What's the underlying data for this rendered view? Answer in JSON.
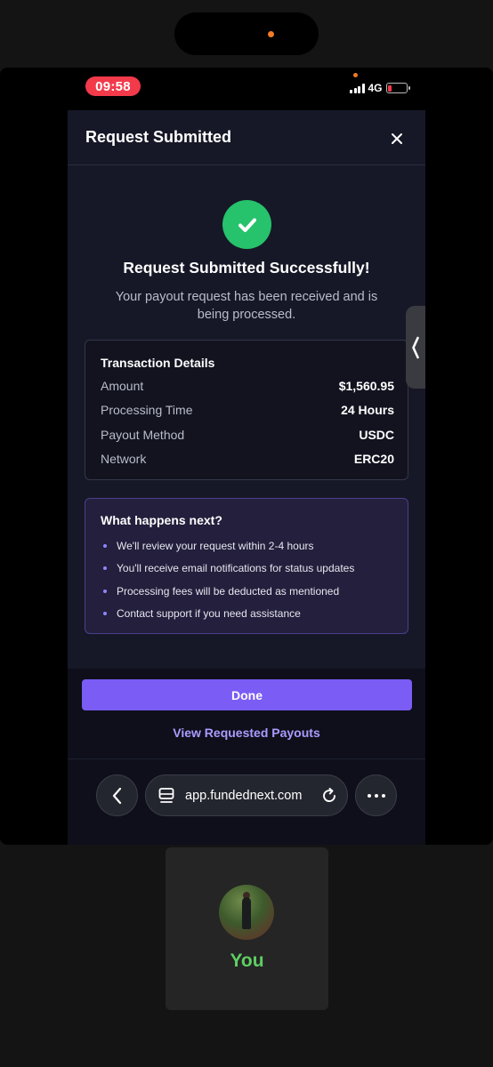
{
  "status_bar": {
    "time": "09:58",
    "network": "4G"
  },
  "modal": {
    "title": "Request Submitted",
    "success_title": "Request Submitted Successfully!",
    "success_subtitle": "Your payout request has been received and is being processed.",
    "details": {
      "title": "Transaction Details",
      "rows": [
        {
          "label": "Amount",
          "value": "$1,560.95"
        },
        {
          "label": "Processing Time",
          "value": "24 Hours"
        },
        {
          "label": "Payout Method",
          "value": "USDC"
        },
        {
          "label": "Network",
          "value": "ERC20"
        }
      ]
    },
    "next_steps": {
      "title": "What happens next?",
      "items": [
        "We'll review your request within 2-4 hours",
        "You'll receive email notifications for status updates",
        "Processing fees will be deducted as mentioned",
        "Contact support if you need assistance"
      ]
    },
    "done_label": "Done",
    "view_link": "View Requested Payouts"
  },
  "browser": {
    "url": "app.fundednext.com"
  },
  "video_call": {
    "participant_label": "You"
  },
  "colors": {
    "accent": "#7b5cf5",
    "success": "#27c26c",
    "link": "#a99cff",
    "time_pill": "#f23a4b",
    "participant_label": "#5fce63"
  },
  "icons": [
    "close-icon",
    "check-icon",
    "back-chevron-icon",
    "tabs-icon",
    "reload-icon",
    "more-icon",
    "side-tab-chevron-icon"
  ]
}
